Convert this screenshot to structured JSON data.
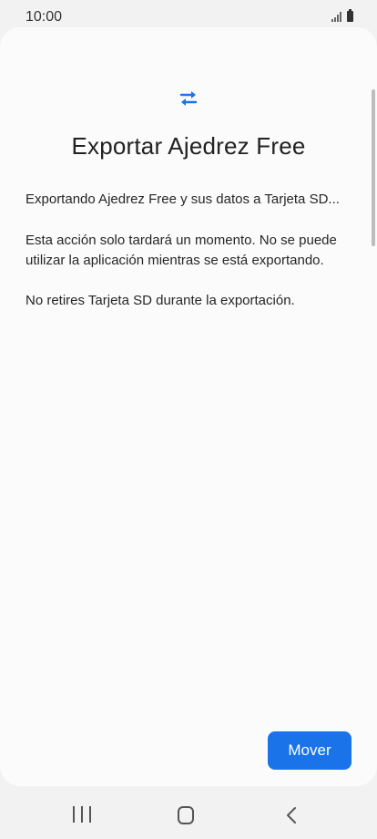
{
  "status_bar": {
    "time": "10:00"
  },
  "dialog": {
    "icon": "transfer-arrows-icon",
    "title": "Exportar Ajedrez Free",
    "paragraphs": [
      "Exportando Ajedrez Free y sus datos a Tarjeta SD...",
      "Esta acción solo tardará un momento. No se puede utilizar la aplicación mientras se está exportando.",
      "No retires Tarjeta SD durante la exportación."
    ],
    "button_label": "Mover"
  },
  "colors": {
    "accent": "#1a73e8",
    "background": "#fbfbfb",
    "text": "#222222"
  },
  "nav_bar": {
    "icons": [
      "recents-icon",
      "home-icon",
      "back-icon"
    ]
  }
}
